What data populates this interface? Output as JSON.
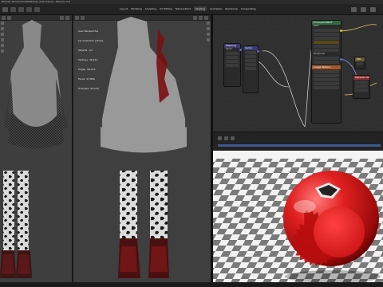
{
  "window": {
    "title": "Blender [D:\\work\\outfit\\BD\\cat_dress.blend] - Blender 3.6"
  },
  "workspace_tabs": [
    "Layout",
    "Modeling",
    "Sculpting",
    "UV Editing",
    "Texture Paint",
    "Shading",
    "Animation",
    "Rendering",
    "Compositing"
  ],
  "active_tab": "Shading",
  "viewport_mid": {
    "overlay_lines": [
      "User Perspective",
      "(1) Collection | Dress",
      "Objects  1/3",
      "Vertices  48,210",
      "Edges  96,014",
      "Faces  47,866",
      "Triangles  95,120"
    ]
  },
  "node_editor": {
    "nodes": [
      {
        "title": "Mapping",
        "header_color": "#3b3b6e",
        "rows": [
          "Vector",
          "Type: Point",
          "Location",
          "Rotation",
          "Scale"
        ]
      },
      {
        "title": "Texture Coordinate",
        "header_color": "#8a3a2f",
        "rows": [
          "Generated",
          "Normal",
          "UV",
          "Object",
          "Camera"
        ]
      },
      {
        "title": "Image Texture",
        "header_color": "#a3572a",
        "rows": [
          "Color",
          "Alpha",
          "Linear",
          "Flat",
          "Repeat"
        ]
      },
      {
        "title": "Mix",
        "header_color": "#6a5a2a",
        "rows": [
          "Factor",
          "Color",
          "A",
          "B"
        ]
      },
      {
        "title": "Principled BSDF",
        "header_color": "#2f6a42",
        "rows": [
          "BSDF",
          "Base Color",
          "Subsurface",
          "Metallic",
          "Specular",
          "Roughness",
          "Sheen",
          "Clearcoat",
          "IOR",
          "Emission",
          "Alpha",
          "Normal"
        ]
      },
      {
        "title": "Material Output",
        "header_color": "#8a2f2f",
        "rows": [
          "All",
          "Surface",
          "Volume",
          "Displacement"
        ]
      },
      {
        "title": "Vector",
        "header_color": "#3b3b6e",
        "rows": [
          "Value"
        ]
      }
    ]
  },
  "colors": {
    "accent_blue": "#3d5a8f",
    "sphere_red": "#d41a1a",
    "checker_dark": "#7a7a7a",
    "checker_light": "#f2f2f2"
  },
  "icons": [
    "menu-icon",
    "file-icon",
    "add-icon",
    "view-icon",
    "select-icon",
    "play-icon",
    "rewind-icon",
    "forward-icon"
  ]
}
